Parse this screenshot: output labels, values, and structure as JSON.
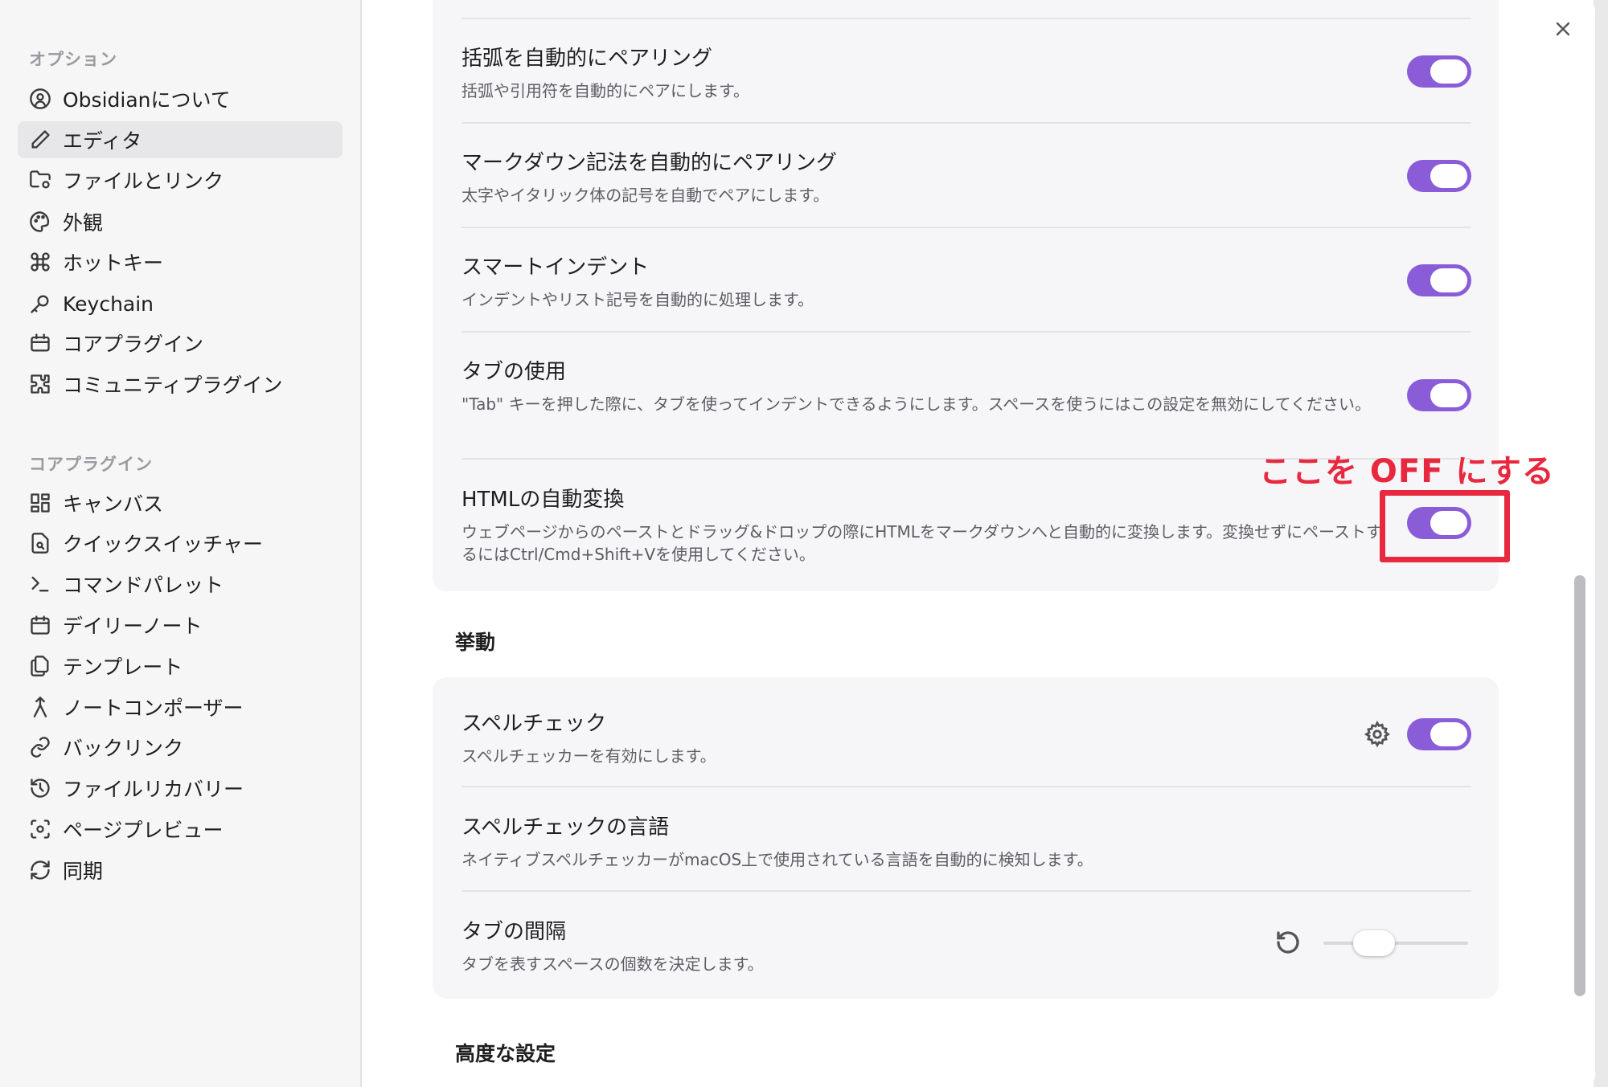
{
  "sidebar": {
    "options_heading": "オプション",
    "options": [
      {
        "label": "Obsidianについて",
        "icon": "user-circle-icon"
      },
      {
        "label": "エディタ",
        "icon": "pencil-icon",
        "active": true
      },
      {
        "label": "ファイルとリンク",
        "icon": "folder-cog-icon"
      },
      {
        "label": "外観",
        "icon": "palette-icon"
      },
      {
        "label": "ホットキー",
        "icon": "command-icon"
      },
      {
        "label": "Keychain",
        "icon": "key-icon"
      },
      {
        "label": "コアプラグイン",
        "icon": "calendar-box-icon"
      },
      {
        "label": "コミュニティプラグイン",
        "icon": "puzzle-icon"
      }
    ],
    "core_heading": "コアプラグイン",
    "core": [
      {
        "label": "キャンバス",
        "icon": "layout-dashboard-icon"
      },
      {
        "label": "クイックスイッチャー",
        "icon": "file-search-icon"
      },
      {
        "label": "コマンドパレット",
        "icon": "terminal-icon"
      },
      {
        "label": "デイリーノート",
        "icon": "calendar-icon"
      },
      {
        "label": "テンプレート",
        "icon": "files-icon"
      },
      {
        "label": "ノートコンポーザー",
        "icon": "merge-icon"
      },
      {
        "label": "バックリンク",
        "icon": "link-icon"
      },
      {
        "label": "ファイルリカバリー",
        "icon": "history-icon"
      },
      {
        "label": "ページプレビュー",
        "icon": "scan-eye-icon"
      },
      {
        "label": "同期",
        "icon": "refresh-icon"
      }
    ]
  },
  "settings_top": [
    {
      "title": "括弧を自動的にペアリング",
      "desc": "括弧や引用符を自動的にペアにします。",
      "enabled": true
    },
    {
      "title": "マークダウン記法を自動的にペアリング",
      "desc": "太字やイタリック体の記号を自動でペアにします。",
      "enabled": true
    },
    {
      "title": "スマートインデント",
      "desc": "インデントやリスト記号を自動的に処理します。",
      "enabled": true
    },
    {
      "title": "タブの使用",
      "desc": "\"Tab\" キーを押した際に、タブを使ってインデントできるようにします。スペースを使うにはこの設定を無効にしてください。",
      "enabled": true
    },
    {
      "title": "HTMLの自動変換",
      "desc": "ウェブページからのペーストとドラッグ&ドロップの際にHTMLをマークダウンへと自動的に変換します。変換せずにペーストするにはCtrl/Cmd+Shift+Vを使用してください。",
      "enabled": true
    }
  ],
  "behavior_heading": "挙動",
  "settings_behavior": [
    {
      "title": "スペルチェック",
      "desc": "スペルチェッカーを有効にします。",
      "enabled": true
    },
    {
      "title": "スペルチェックの言語",
      "desc": "ネイティブスペルチェッカーがmacOS上で使用されている言語を自動的に検知します。"
    },
    {
      "title": "タブの間隔",
      "desc": "タブを表すスペースの個数を決定します。",
      "slider_level": 0.35
    }
  ],
  "advanced_heading": "高度な設定",
  "annotation": {
    "text": "ここを OFF にする",
    "color": "#e8283f"
  },
  "colors": {
    "accent": "#8a5cd8"
  }
}
